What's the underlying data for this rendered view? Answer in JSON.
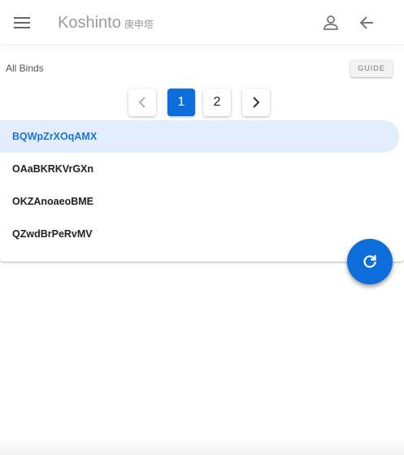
{
  "app": {
    "title": "Koshinto",
    "subtitle": "庚申塔"
  },
  "icons": {
    "menu": "menu-icon",
    "account": "account-icon",
    "back": "arrow-back-icon",
    "prev": "chevron-left-icon",
    "next": "chevron-right-icon",
    "refresh": "refresh-icon"
  },
  "card": {
    "title": "All Binds",
    "guide_label": "GUIDE"
  },
  "pagination": {
    "pages": [
      "1",
      "2"
    ],
    "current": "1"
  },
  "binds": [
    {
      "label": "BQWpZrXOqAMX",
      "selected": true
    },
    {
      "label": "OAaBKRKVrGXn",
      "selected": false
    },
    {
      "label": "OKZAnoaeoBME",
      "selected": false
    },
    {
      "label": "QZwdBrPeRvMV",
      "selected": false
    }
  ],
  "colors": {
    "accent": "#0d6edb",
    "selected_bg": "#e2eefc",
    "selected_text": "#1a73d9"
  }
}
